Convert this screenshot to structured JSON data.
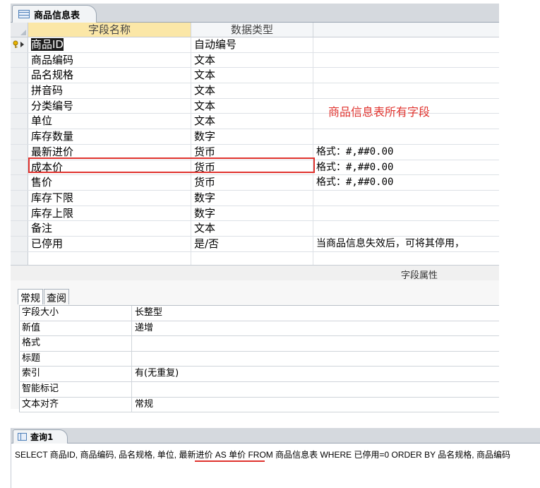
{
  "design": {
    "tab_title": "商品信息表",
    "col_name": "字段名称",
    "col_type": "数据类型",
    "col_desc": "",
    "annotation": "商品信息表所有字段",
    "fields": [
      {
        "name": "商品ID",
        "type": "自动编号",
        "desc": ""
      },
      {
        "name": "商品编码",
        "type": "文本",
        "desc": ""
      },
      {
        "name": "品名规格",
        "type": "文本",
        "desc": ""
      },
      {
        "name": "拼音码",
        "type": "文本",
        "desc": ""
      },
      {
        "name": "分类编号",
        "type": "文本",
        "desc": ""
      },
      {
        "name": "单位",
        "type": "文本",
        "desc": ""
      },
      {
        "name": "库存数量",
        "type": "数字",
        "desc": ""
      },
      {
        "name": "最新进价",
        "type": "货币",
        "desc": "格式：#,##0.00"
      },
      {
        "name": "成本价",
        "type": "货币",
        "desc": "格式：#,##0.00"
      },
      {
        "name": "售价",
        "type": "货币",
        "desc": "格式：#,##0.00"
      },
      {
        "name": "库存下限",
        "type": "数字",
        "desc": ""
      },
      {
        "name": "库存上限",
        "type": "数字",
        "desc": ""
      },
      {
        "name": "备注",
        "type": "文本",
        "desc": ""
      },
      {
        "name": "已停用",
        "type": "是/否",
        "desc": "当商品信息失效后，可将其停用，"
      }
    ],
    "props_title": "字段属性",
    "prop_tabs": [
      "常规",
      "查阅"
    ],
    "properties": [
      {
        "label": "字段大小",
        "value": "长整型"
      },
      {
        "label": "新值",
        "value": "递增"
      },
      {
        "label": "格式",
        "value": ""
      },
      {
        "label": "标题",
        "value": ""
      },
      {
        "label": "索引",
        "value": "有(无重复)"
      },
      {
        "label": "智能标记",
        "value": ""
      },
      {
        "label": "文本对齐",
        "value": "常规"
      }
    ]
  },
  "query": {
    "tab_title": "查询1",
    "sql": "SELECT 商品ID, 商品编码, 品名规格, 单位, 最新进价 AS 单价 FROM 商品信息表 WHERE 已停用=0 ORDER BY 品名规格, 商品编码"
  },
  "colors": {
    "highlight": "#e0332e",
    "header_selected": "#fbe7a7"
  }
}
